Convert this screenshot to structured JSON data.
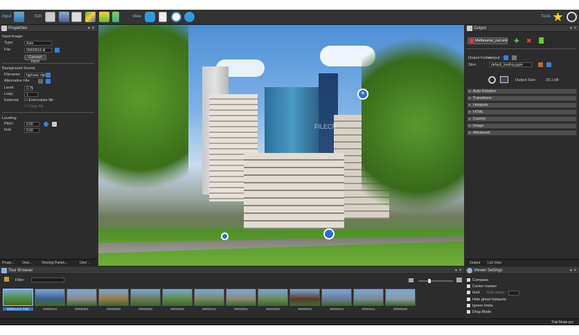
{
  "toolbar": {
    "input_label": "Input",
    "edit_label": "Edit",
    "view_label": "View",
    "tools_label": "Tools"
  },
  "properties": {
    "title": "Properties",
    "input_image_section": "Input Image:",
    "type_label": "Type:",
    "type_value": "Auto",
    "file_label": "File:",
    "file_value": "00000616.tif",
    "convert_button": "Convert input",
    "bg_sound_section": "Background Sound:",
    "filename_label": "Filename:",
    "filename_value": "bgmusic.mp3",
    "alt_file_label": "Alternative File:",
    "level_label": "Level:",
    "level_value": "0.75",
    "loop_label": "Loop:",
    "loop_value": "1",
    "external_label": "External:",
    "externalize_label": "Externalize file",
    "copy_label": "Copy file",
    "leveling_section": "Leveling:",
    "pitch_label": "Pitch:",
    "pitch_value": "0.00",
    "roll_label": "Roll:",
    "roll_value": "0.00"
  },
  "left_tabs": [
    "Prope...",
    "Over...",
    "Viewing Param...",
    "User ..."
  ],
  "viewer": {
    "watermark": "FILECR"
  },
  "output": {
    "title": "Output",
    "file_name": "Melbourne_out.xml",
    "folder_label": "Output Folder:",
    "folder_value": "output",
    "skin_label": "Skin:",
    "skin_value": "default_loading.ggsk",
    "size_label": "Output Size:",
    "size_value": "29,1 kB",
    "sections": [
      "Auto Rotation",
      "Transitions",
      "Hotspots",
      "HTML",
      "Control",
      "Image",
      "Advanced"
    ]
  },
  "right_tabs": [
    "Output",
    "List View"
  ],
  "tour_browser": {
    "title": "Tour Browser",
    "filter_label": "Filter:",
    "items": [
      {
        "label": "Melbourne Park",
        "color": "#4f8a3c"
      },
      {
        "label": "00000323",
        "color": "#3d5f8c"
      },
      {
        "label": "00000301",
        "color": "#8a8a8a"
      },
      {
        "label": "00000599",
        "color": "#9a7a4a"
      },
      {
        "label": "00003648",
        "color": "#6a7a5a"
      },
      {
        "label": "00003650",
        "color": "#5a8a4a"
      },
      {
        "label": "00000313",
        "color": "#7a8a6a"
      },
      {
        "label": "00004601",
        "color": "#8a8a7a"
      },
      {
        "label": "00004600",
        "color": "#6a8a5a"
      },
      {
        "label": "00000640",
        "color": "#5a3a2a"
      },
      {
        "label": "00000615",
        "color": "#6a7a9a"
      },
      {
        "label": "00004611",
        "color": "#7a8a9a"
      },
      {
        "label": "00000539",
        "color": "#8a9aaa"
      }
    ]
  },
  "viewer_settings": {
    "title": "Viewer Settings",
    "items": [
      "Compass",
      "Center marker",
      "Grid",
      "Hide ghost hotspots",
      "Ignore limits",
      "Drag Mode"
    ],
    "grid_steps_label": "Grid steps:"
  },
  "status": {
    "mode": "Trial Mode pro"
  }
}
